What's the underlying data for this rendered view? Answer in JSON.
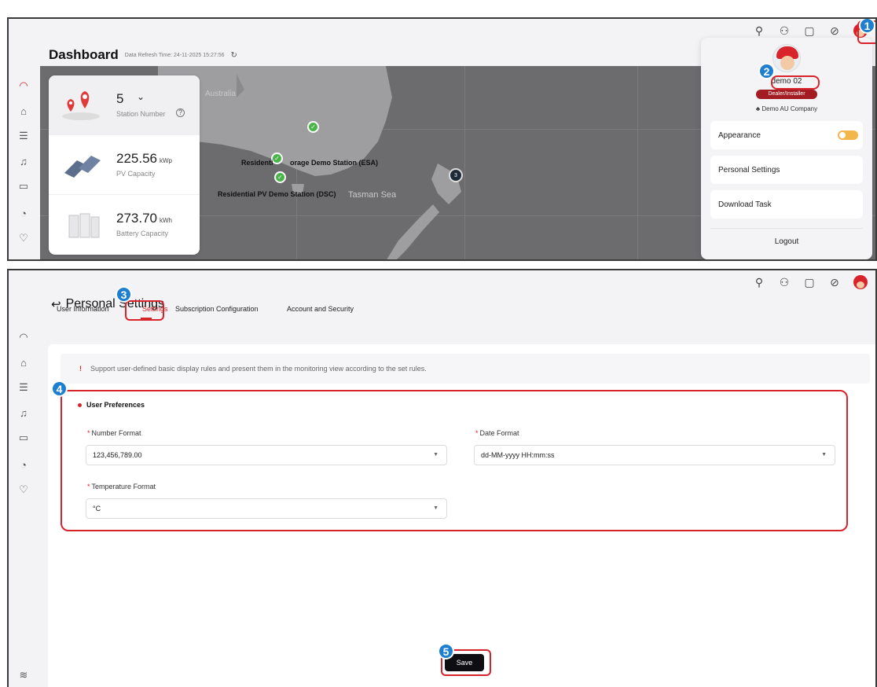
{
  "topbar": {
    "icons": [
      "search-icon",
      "device-icon",
      "message-icon",
      "globe-icon",
      "avatar"
    ]
  },
  "sidebar": {
    "icons": [
      "dashboard-icon",
      "home-icon",
      "device-list-icon",
      "alarm-icon",
      "report-icon",
      "chart-icon",
      "heart-icon"
    ]
  },
  "dashboard": {
    "title": "Dashboard",
    "refresh_text": "Data Refresh Time: 24-11-2025 15:27:56",
    "stats": [
      {
        "value": "5",
        "unit": "",
        "label": "Station Number",
        "dropdown": "⌄"
      },
      {
        "value": "225.56",
        "unit": "kWp",
        "label": "PV Capacity"
      },
      {
        "value": "273.70",
        "unit": "kWh",
        "label": "Battery Capacity"
      }
    ],
    "map": {
      "labels": {
        "australia": "Australia",
        "tasman": "Tasman Sea",
        "esa": "Residential Storage Demo Station  (ESA)",
        "esa_prefix": "Residenti",
        "esa_suffix": "orage Demo Station  (ESA)",
        "dsc": "Residential PV Demo Station  (DSC)",
        "cluster": "3"
      }
    }
  },
  "user_menu": {
    "name": "demo 02",
    "role": "Dealer/Installer",
    "company": "Demo AU Company",
    "items": [
      "Appearance",
      "Personal Settings",
      "Download Task"
    ],
    "logout": "Logout"
  },
  "personal_settings": {
    "title": "Personal Settings",
    "tabs": [
      "User Information",
      "Settings",
      "Subscription Configuration",
      "Account and Security"
    ],
    "notice": "Support user-defined basic display rules and present them in the monitoring view according to the set rules.",
    "section_title": "User Preferences",
    "fields": {
      "number_format": {
        "label": "Number Format",
        "value": "123,456,789.00"
      },
      "date_format": {
        "label": "Date Format",
        "value": "dd-MM-yyyy HH:mm:ss"
      },
      "temperature_format": {
        "label": "Temperature Format",
        "value": "°C"
      }
    },
    "save_label": "Save"
  },
  "markers": [
    "1",
    "2",
    "3",
    "4",
    "5"
  ],
  "colors": {
    "accent": "#d8232a",
    "marker": "#1e7fd0",
    "map": "#6c6c6f",
    "save": "#0e0e12"
  }
}
